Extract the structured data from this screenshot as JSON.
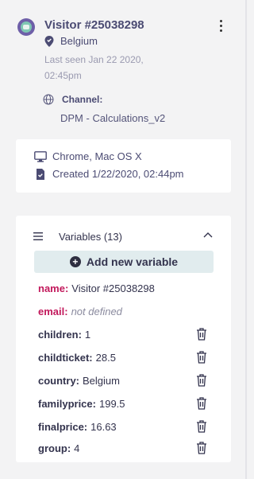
{
  "visitor": {
    "name": "Visitor #25038298",
    "country": "Belgium",
    "last_seen": "Last seen Jan 22 2020, 02:45pm",
    "channel_label": "Channel:",
    "channel_value": "DPM - Calculations_v2"
  },
  "device": {
    "browser": "Chrome, Mac OS X",
    "created": "Created 1/22/2020, 02:44pm"
  },
  "variables": {
    "title": "Variables (13)",
    "add_label": "Add new variable",
    "items": [
      {
        "key": "name:",
        "value": "Visitor #25038298"
      },
      {
        "key": "email:",
        "value": "not defined"
      },
      {
        "key": "children:",
        "value": "1"
      },
      {
        "key": "childticket:",
        "value": "28.5"
      },
      {
        "key": "country:",
        "value": "Belgium"
      },
      {
        "key": "familyprice:",
        "value": "199.5"
      },
      {
        "key": "finalprice:",
        "value": "16.63"
      },
      {
        "key": "group:",
        "value": "4"
      }
    ]
  },
  "colors": {
    "accent_key": "#c2185b",
    "button_bg": "#e1ecee",
    "panel_bg": "#f3f3f4"
  }
}
